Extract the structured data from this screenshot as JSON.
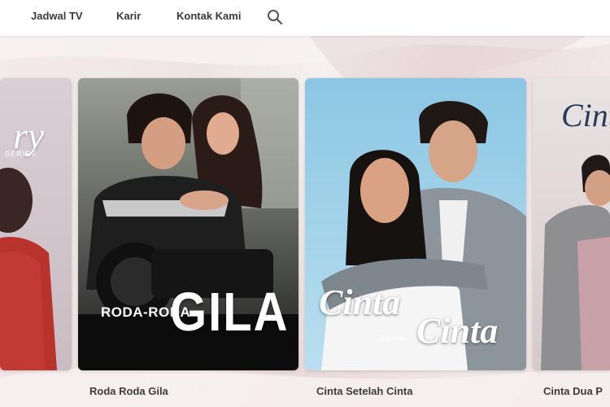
{
  "nav": {
    "items": [
      {
        "label": "Jadwal TV"
      },
      {
        "label": "Karir"
      },
      {
        "label": "Kontak Kami"
      }
    ],
    "search_icon": "search-icon"
  },
  "carousel": {
    "cards": [
      {
        "caption": "",
        "poster_title": "ry",
        "poster_subtitle": "SERIES"
      },
      {
        "caption": "Roda Roda Gila",
        "poster_title_small": "RODA-RODA",
        "poster_title_big": "GILA"
      },
      {
        "caption": "Cinta Setelah Cinta",
        "poster_title_1": "Cinta",
        "poster_title_mid": "Setelah",
        "poster_title_2": "Cinta"
      },
      {
        "caption": "Cinta Dua P",
        "poster_title": "Cint"
      }
    ]
  },
  "colors": {
    "nav_text": "#3a3a3a",
    "caption_text": "#3b3b3b",
    "background": "#efe4e4"
  }
}
